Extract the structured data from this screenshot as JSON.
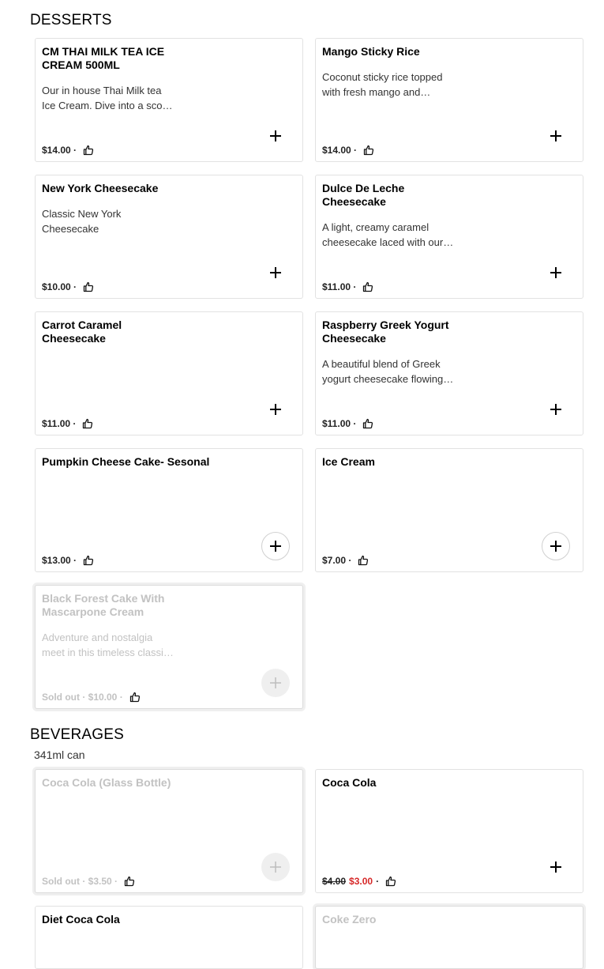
{
  "desserts": {
    "title": "DESSERTS",
    "items": [
      {
        "name": "CM THAI MILK TEA ICE CREAM 500ML",
        "desc": "Our in house Thai Milk tea Ice Cream. Dive into a sco…",
        "price": "$14.00 ·"
      },
      {
        "name": "Mango Sticky Rice",
        "desc": "Coconut sticky rice topped with fresh mango and…",
        "price": "$14.00 ·"
      },
      {
        "name": "New York Cheesecake",
        "desc": "Classic New York Cheesecake",
        "price": "$10.00 ·"
      },
      {
        "name": "Dulce De Leche Cheesecake",
        "desc": "A light, creamy caramel cheesecake laced with our…",
        "price": "$11.00 ·"
      },
      {
        "name": "Carrot Caramel Cheesecake",
        "desc": "",
        "price": "$11.00 ·"
      },
      {
        "name": "Raspberry Greek Yogurt Cheesecake",
        "desc": "A beautiful blend of Greek yogurt cheesecake flowing…",
        "price": "$11.00 ·"
      },
      {
        "name": "Pumpkin Cheese Cake- Sesonal",
        "desc": "",
        "price": "$13.00 ·"
      },
      {
        "name": "Ice Cream",
        "desc": "",
        "price": "$7.00 ·"
      },
      {
        "name": "Black Forest Cake With Mascarpone Cream",
        "desc": "Adventure and nostalgia meet in this timeless classi…",
        "price": "Sold out · $10.00 ·"
      }
    ]
  },
  "beverages": {
    "title": "BEVERAGES",
    "subtitle": "341ml can",
    "items": [
      {
        "name": "Coca Cola (Glass Bottle)",
        "price": "Sold out · $3.50 ·"
      },
      {
        "name": "Coca Cola",
        "old_price": "$4.00 ",
        "sale_price": "$3.00",
        "price_suffix": " ·"
      },
      {
        "name": "Diet Coca Cola"
      },
      {
        "name": "Coke Zero"
      }
    ]
  },
  "colors": {
    "sale": "#d62828",
    "soldout_text": "#c2c2c2"
  },
  "icons": {
    "like": "thumbs-up-icon",
    "add": "plus-icon"
  }
}
